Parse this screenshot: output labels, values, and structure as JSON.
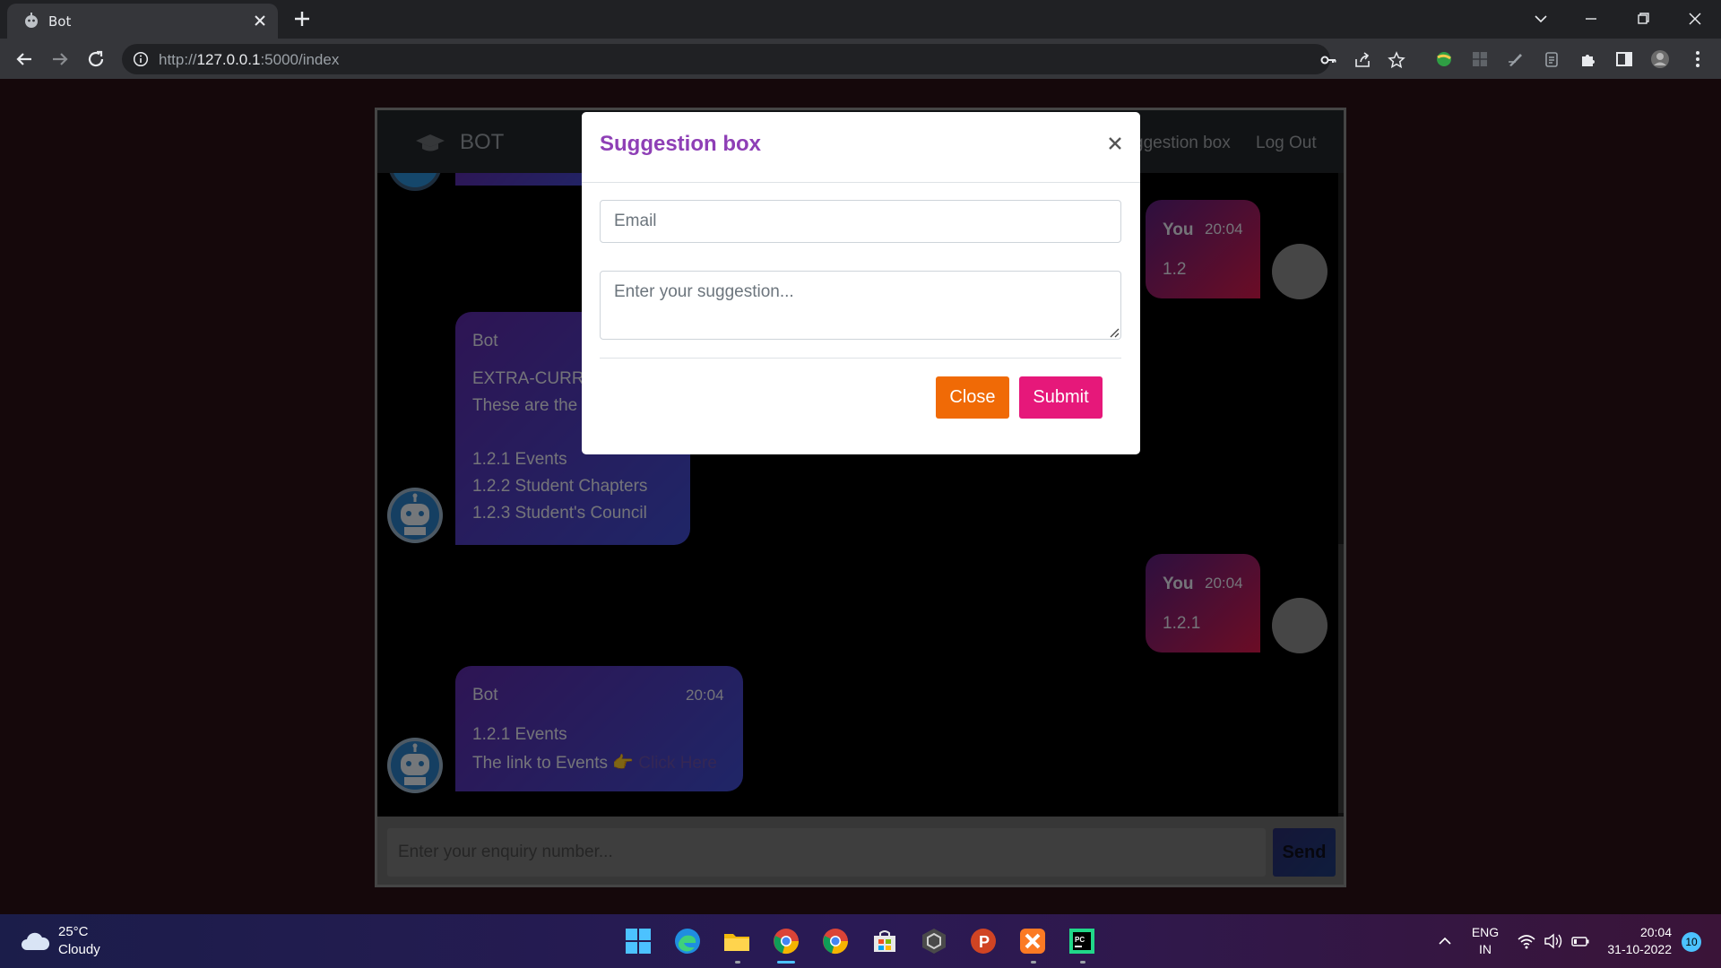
{
  "browser": {
    "tab_title": "Bot",
    "url_prefix": "http://",
    "url_host": "127.0.0.1",
    "url_rest": ":5000/index"
  },
  "app": {
    "brand": "BOT",
    "nav_suggestion": "ggestion box",
    "nav_logout": "Log Out",
    "messages": {
      "you1": {
        "name": "You",
        "time": "20:04",
        "text": "1.2"
      },
      "bot1": {
        "name": "Bot",
        "lines": [
          "EXTRA-CURR",
          "These are the",
          "",
          "1.2.1 Events",
          "1.2.2 Student Chapters",
          "1.2.3 Student's Council"
        ]
      },
      "you2": {
        "name": "You",
        "time": "20:04",
        "text": "1.2.1"
      },
      "bot2": {
        "name": "Bot",
        "time": "20:04",
        "line1": "1.2.1 Events",
        "line2": "The link to Events",
        "emoji": "👉",
        "link": "Click Here"
      }
    },
    "input_placeholder": "Enter your enquiry number...",
    "send_label": "Send"
  },
  "modal": {
    "title": "Suggestion box",
    "email_placeholder": "Email",
    "suggestion_placeholder": "Enter your suggestion...",
    "close_label": "Close",
    "submit_label": "Submit"
  },
  "taskbar": {
    "temp": "25°C",
    "condition": "Cloudy",
    "lang1": "ENG",
    "lang2": "IN",
    "time": "20:04",
    "date": "31-10-2022",
    "notifications": "10"
  },
  "colors": {
    "modal_title": "#8e3fb6",
    "close_button": "#f06a06",
    "submit_button": "#e6187a"
  }
}
